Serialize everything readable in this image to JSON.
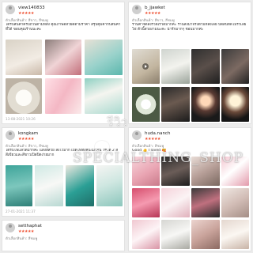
{
  "reviews": [
    {
      "username": "view140833",
      "stars": "★★★★★",
      "meta": "ตัวเลือกสินค้า: สีขาว, สีชมพู",
      "body": "ได้รับสินค้าครบถ้วนตามที่สั่ง คุณภาพดีสวยดีตามราคา สรุปคุ้มค่ากับสินค้าที่ได้ ขอบคุณร้านนะคะ",
      "date": "13-08-2021 10:26",
      "photo_count": 6
    },
    {
      "username": "b_jjawket",
      "stars": "★★★★★",
      "meta": "ตัวเลือกสินค้า: สีขาว, สีชมพู",
      "body": "ร้านค้าจัดส่งรวดเร็วดีมากค่ะ ร้านส่งมาจริงตามที่สั่งเลย ปิดสนิทดีไม่รั่วเลยไฟ ตัวนี้สวยงามนะคะ น่ารักมากๆ ชอบมากค่ะ",
      "date": "",
      "photo_count": 8
    },
    {
      "username": "kongkam",
      "stars": "★★★★★",
      "meta": "ตัวเลือกสินค้า: สีขาว, สีชมพู",
      "body": "ได้รับไฟแล้วดีมากค่ะ แสงสีสวย ส่งไวมาก เปิดไฟทั้งคืนไม่ร้อน ใช้ได้ 2 สี สีเขียวและสีขาวเปิดปิดง่ายมาก",
      "date": "27-01-2021 11:37",
      "photo_count": 4
    },
    {
      "username": "huda.nanch",
      "stars": "★★★★★",
      "meta": "ตัวเลือกสินค้า: สีชมพู",
      "body": "Good 👍 I loved 🥰",
      "date": "",
      "photo_count": 12
    },
    {
      "username": "setthaphat",
      "stars": "★★★★★",
      "meta": "ตัวเลือกสินค้า: สีชมพู",
      "body": "",
      "date": ""
    }
  ],
  "watermark": {
    "shop": "SPECIALTHING_SHOP",
    "review_word": "รีวิว"
  },
  "colors": {
    "star": "#ee4d2d",
    "photo_pink": "#f4c6cf",
    "photo_teal": "#3aa8a0",
    "photo_dark": "#3a3a3a",
    "photo_light": "#f3f1ec"
  }
}
